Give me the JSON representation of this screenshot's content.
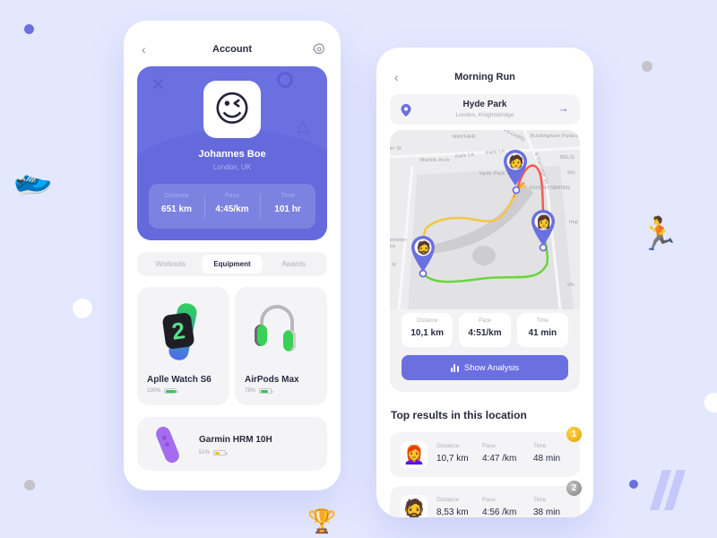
{
  "colors": {
    "background": "#e4e8fe",
    "accent": "#6a70e0",
    "battery_green": "#34c759",
    "battery_yellow": "#f5c518",
    "medal_gold": "#f0b400",
    "medal_silver": "#9a9a9a"
  },
  "decorations": {
    "sneaker_icon": "👟",
    "runner_icon": "🏃",
    "trophy_icon": "🏆"
  },
  "account": {
    "title": "Account",
    "back_icon": "chevron-left-icon",
    "settings_icon": "gear-icon",
    "profile": {
      "avatar_icon": "😉",
      "name": "Johannes Boe",
      "location": "London, UK",
      "stats": [
        {
          "label": "Distance",
          "value": "651 km"
        },
        {
          "label": "Pace",
          "value": "4:45/km"
        },
        {
          "label": "Time",
          "value": "101 hr"
        }
      ]
    },
    "tabs": [
      {
        "label": "Workouts",
        "active": false
      },
      {
        "label": "Equipment",
        "active": true
      },
      {
        "label": "Awards",
        "active": false
      }
    ],
    "equipment": [
      {
        "name": "Aplle Watch S6",
        "battery_label": "100%",
        "battery_percent": 100,
        "icon": "⌚"
      },
      {
        "name": "AirPods Max",
        "battery_label": "78%",
        "battery_percent": 78,
        "icon": "🎧"
      },
      {
        "name": "Garmin HRM 10H",
        "battery_label": "51%",
        "battery_percent": 51,
        "icon": "💜"
      }
    ]
  },
  "run": {
    "title": "Morning Run",
    "back_icon": "chevron-left-icon",
    "location": {
      "name": "Hyde Park",
      "subtitle": "London, Khightsbridge",
      "pin_icon": "map-pin-icon",
      "arrow": "→"
    },
    "map": {
      "labels": [
        "MAYFAIR",
        "Piccadilly",
        "Buckingham Palace",
        "er St",
        "Park Ln",
        "Park Ln",
        "Marble Arch",
        "BELG",
        "Hyde Park",
        "S Carriage Dr",
        "Slo",
        "KNIGHTSBRIDG",
        "einster",
        "ns",
        "R",
        "Imp",
        "Vic"
      ],
      "runner_avatars": [
        "🧔",
        "👩",
        "🧑"
      ]
    },
    "stats": [
      {
        "label": "Distance",
        "value": "10,1 km"
      },
      {
        "label": "Pace",
        "value": "4:51/km"
      },
      {
        "label": "Time",
        "value": "41 min"
      }
    ],
    "analysis_button": "Show Analysis",
    "results_title": "Top results in this location",
    "results": [
      {
        "rank": "1",
        "avatar": "👩‍🦰",
        "distance_label": "Distance",
        "distance": "10,7 km",
        "pace_label": "Pace",
        "pace": "4:47 /km",
        "time_label": "Time",
        "time": "48 min"
      },
      {
        "rank": "2",
        "avatar": "🧔",
        "distance_label": "Distance",
        "distance": "8,53 km",
        "pace_label": "Pace",
        "pace": "4:56 /km",
        "time_label": "Time",
        "time": "38 min"
      }
    ]
  }
}
